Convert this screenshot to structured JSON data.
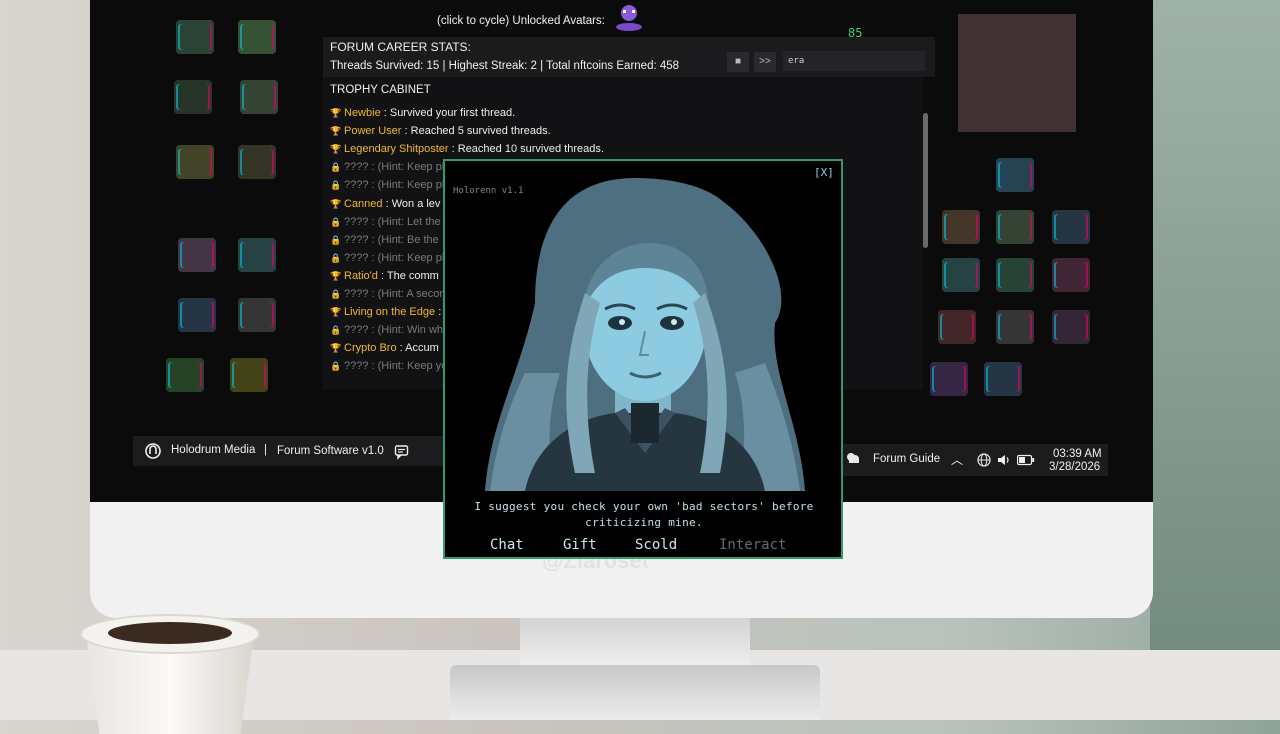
{
  "header": {
    "avatars_label": "(click to cycle) Unlocked Avatars:",
    "score_badge": "85"
  },
  "stats": {
    "title": "FORUM CAREER STATS:",
    "summary": "Threads Survived: 15 | Highest Streak: 2 | Total nftcoins Earned: 458"
  },
  "media": {
    "stop_icon": "■",
    "forward_icon": ">>",
    "input_value": "era"
  },
  "trophies": {
    "title": "TROPHY CABINET",
    "items": [
      {
        "name": "Newbie",
        "desc": " : Survived your first thread.",
        "locked": false
      },
      {
        "name": "Power User",
        "desc": " : Reached 5 survived threads.",
        "locked": false
      },
      {
        "name": "Legendary Shitposter",
        "desc": " : Reached 10 survived threads.",
        "locked": false
      },
      {
        "name": "",
        "desc": "???? : (Hint: Keep pl",
        "locked": true
      },
      {
        "name": "",
        "desc": "???? : (Hint: Keep pl",
        "locked": true
      },
      {
        "name": "Canned",
        "desc": " : Won a lev",
        "locked": false
      },
      {
        "name": "",
        "desc": "???? : (Hint: Let the",
        "locked": true
      },
      {
        "name": "",
        "desc": "???? : (Hint: Be the",
        "locked": true
      },
      {
        "name": "",
        "desc": "???? : (Hint: Keep pl",
        "locked": true
      },
      {
        "name": "Ratio'd",
        "desc": " : The comm",
        "locked": false
      },
      {
        "name": "",
        "desc": "???? : (Hint: A secon",
        "locked": true
      },
      {
        "name": "Living on the Edge",
        "desc": " :",
        "locked": false
      },
      {
        "name": "",
        "desc": "???? : (Hint: Win whe",
        "locked": true
      },
      {
        "name": "Crypto Bro",
        "desc": " : Accum",
        "locked": false
      },
      {
        "name": "",
        "desc": "???? : (Hint: Keep yo",
        "locked": true
      }
    ]
  },
  "taskbar": {
    "brand": "Holodrum Media",
    "separator": "|",
    "software": "Forum Software v1.0",
    "guide": "Forum Guide",
    "time": "03:39 AM",
    "date": "3/28/2026"
  },
  "dialog": {
    "version": "Holorenn v1.1",
    "close_label": "[X]",
    "quote": "I suggest you check your own 'bad sectors' before criticizing mine.",
    "actions": {
      "chat": "Chat",
      "gift": "Gift",
      "scold": "Scold",
      "interact": "Interact"
    }
  },
  "watermark": "@Ziaroset",
  "colors": {
    "accent_border": "#2f9a6a",
    "trophy_gold": "#f0b830",
    "locked_gray": "#7a7a7a"
  }
}
